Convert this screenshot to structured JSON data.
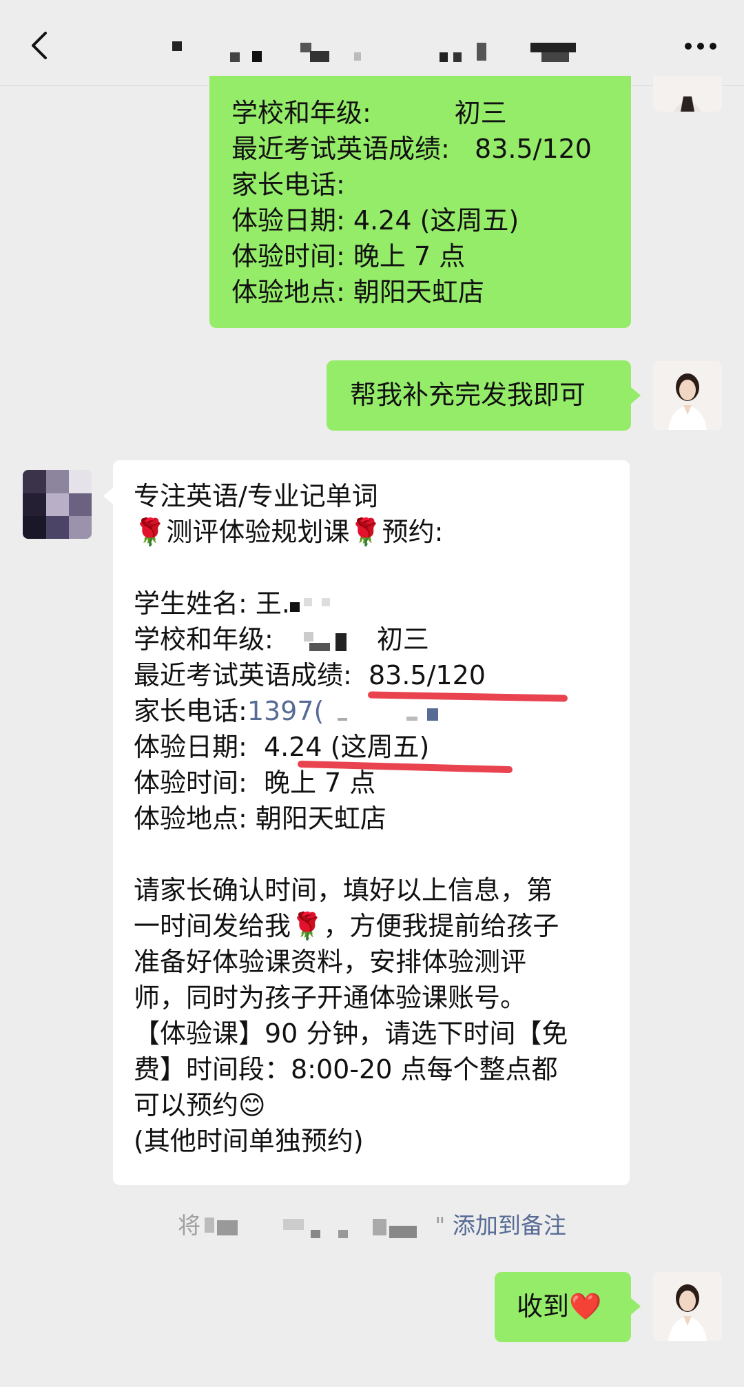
{
  "nav": {
    "back_icon": "chevron-left-icon",
    "more_icon": "more-dots-icon"
  },
  "top_message": {
    "lines": [
      "学校和年级:          初三",
      "最近考试英语成绩:   83.5/120",
      "家长电话:",
      "体验日期: 4.24 (这周五)",
      "体验时间: 晚上 7 点",
      "体验地点: 朝阳天虹店"
    ]
  },
  "request_message": {
    "text": "帮我补充完发我即可"
  },
  "reply_message": {
    "header1": "专注英语/专业记单词",
    "header2": "测评体验规划课",
    "header2_suffix": "预约:",
    "rose_icon": "🌹",
    "name_label": "学生姓名: 王.",
    "school_label": "学校和年级:",
    "school_value": "初三",
    "score_label": "最近考试英语成绩:",
    "score_value": "83.5/120",
    "phone_label": "家长电话:",
    "phone_value": "1397(",
    "date_line": "体验日期:  4.24 (这周五)",
    "time_line": "体验时间:  晚上 7 点",
    "place_line": "体验地点: 朝阳天虹店",
    "para1": "请家长确认时间，填好以上信息，第",
    "para2a": "一时间发给我",
    "para2b": "，方便我提前给孩子",
    "para3": "准备好体验课资料，安排体验测评",
    "para4": "师，同时为孩子开通体验课账号。",
    "para5": "【体验课】90 分钟，请选下时间【免",
    "para6": "费】时间段：8:00-20 点每个整点都",
    "para7": "可以预约",
    "smile_icon": "😊",
    "para8": "(其他时间单独预约)"
  },
  "system_note": {
    "prefix": "将",
    "quote": "\"",
    "link": "添加到备注"
  },
  "final_message": {
    "text": "收到",
    "heart_icon": "❤️"
  },
  "colors": {
    "sent_bubble": "#95ec69",
    "received_bubble": "#ffffff",
    "background": "#ededed",
    "link": "#576b95",
    "annotation": "#e8434f"
  }
}
